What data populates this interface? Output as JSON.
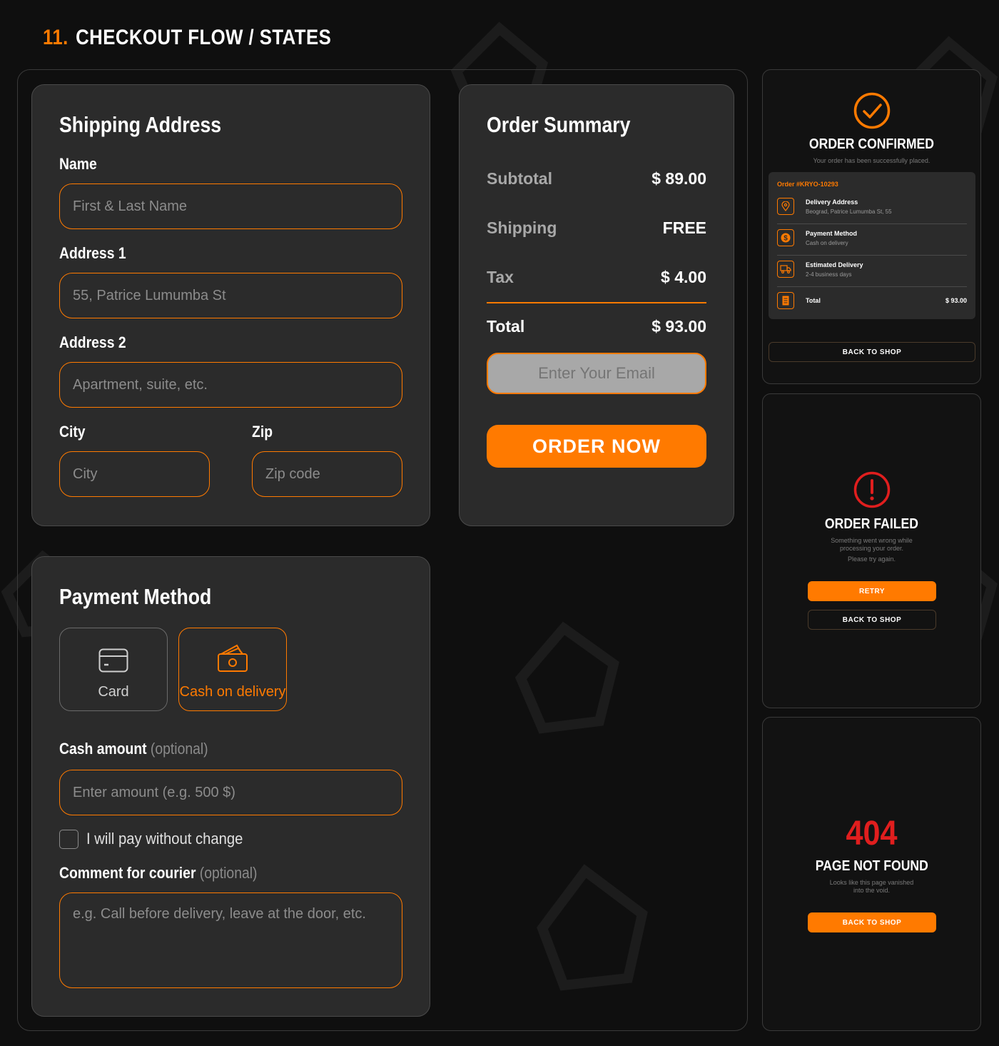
{
  "section": {
    "number": "11.",
    "title": "CHECKOUT FLOW / STATES"
  },
  "shipping": {
    "title": "Shipping Address",
    "name_label": "Name",
    "name_placeholder": "First & Last Name",
    "address1_label": "Address 1",
    "address1_placeholder": "55, Patrice Lumumba St",
    "address2_label": "Address 2",
    "address2_placeholder": "Apartment, suite, etc.",
    "city_label": "City",
    "city_placeholder": "City",
    "zip_label": "Zip",
    "zip_placeholder": "Zip code"
  },
  "summary": {
    "title": "Order Summary",
    "subtotal_label": "Subtotal",
    "subtotal_value": "$ 89.00",
    "shipping_label": "Shipping",
    "shipping_value": "FREE",
    "tax_label": "Tax",
    "tax_value": "$ 4.00",
    "total_label": "Total",
    "total_value": "$ 93.00",
    "email_placeholder": "Enter Your Email",
    "order_button": "ORDER NOW"
  },
  "payment": {
    "title": "Payment Method",
    "options": [
      {
        "label": "Card",
        "icon": "credit-card-icon",
        "selected": false
      },
      {
        "label": "Cash on delivery",
        "icon": "cash-icon",
        "selected": true
      }
    ],
    "cash_label": "Cash amount",
    "cash_optional": "(optional)",
    "cash_placeholder": "Enter amount (e.g. 500 $)",
    "no_change_label": "I will pay without change",
    "comment_label": "Comment for courier",
    "comment_optional": "(optional)",
    "comment_placeholder": "e.g. Call before delivery, leave at the door, etc."
  },
  "confirmed": {
    "title": "ORDER CONFIRMED",
    "subtitle": "Your order has been successfully placed.",
    "order_id": "Order #KRYO-10293",
    "details": [
      {
        "icon": "location-pin-icon",
        "title": "Delivery Address",
        "value": "Beograd, Patrice Lumumba St, 55"
      },
      {
        "icon": "dollar-coin-icon",
        "title": "Payment Method",
        "value": "Cash on delivery"
      },
      {
        "icon": "truck-icon",
        "title": "Estimated Delivery",
        "value": "2-4 business days"
      }
    ],
    "total_label": "Total",
    "total_value": "$ 93.00",
    "back_button": "BACK TO SHOP"
  },
  "failed": {
    "title": "ORDER FAILED",
    "line1": "Something went wrong while",
    "line2": "processing your order.",
    "line3": "Please try again.",
    "retry_button": "RETRY",
    "back_button": "BACK TO SHOP"
  },
  "notfound": {
    "code": "404",
    "title": "PAGE NOT FOUND",
    "line1": "Looks like this page vanished",
    "line2": "into the void.",
    "back_button": "BACK TO SHOP"
  },
  "colors": {
    "accent": "#ff7a00",
    "error": "#e01e1e",
    "card": "#2b2b2b",
    "background": "#0f0f0f"
  }
}
